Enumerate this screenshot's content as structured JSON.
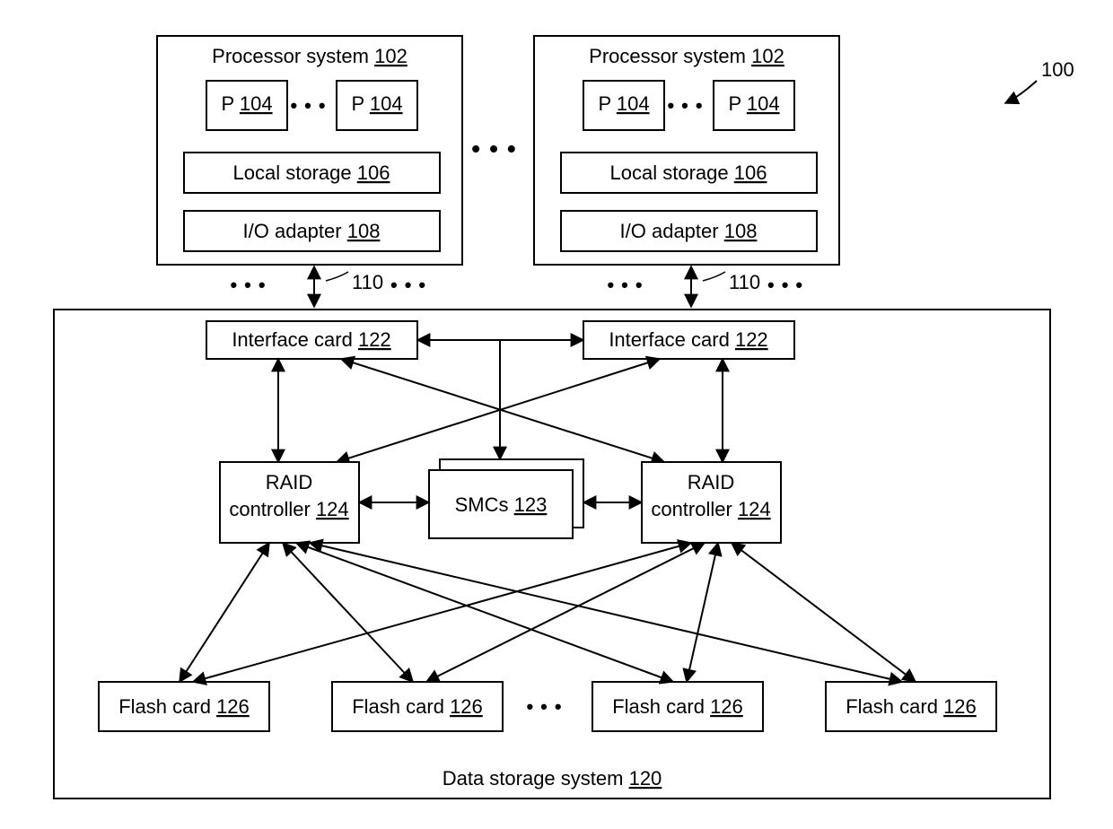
{
  "system_ref": "100",
  "processor_system": {
    "label": "Processor system",
    "ref": "102"
  },
  "processor": {
    "label": "P",
    "ref": "104"
  },
  "local_storage": {
    "label": "Local storage",
    "ref": "106"
  },
  "io_adapter": {
    "label": "I/O adapter",
    "ref": "108"
  },
  "bus_ref": "110",
  "interface_card": {
    "label": "Interface card",
    "ref": "122"
  },
  "raid": {
    "label_line1": "RAID",
    "label_line2": "controller",
    "ref": "124"
  },
  "smcs": {
    "label": "SMCs",
    "ref": "123"
  },
  "flash": {
    "label": "Flash card",
    "ref": "126"
  },
  "dss": {
    "label": "Data storage system",
    "ref": "120"
  }
}
